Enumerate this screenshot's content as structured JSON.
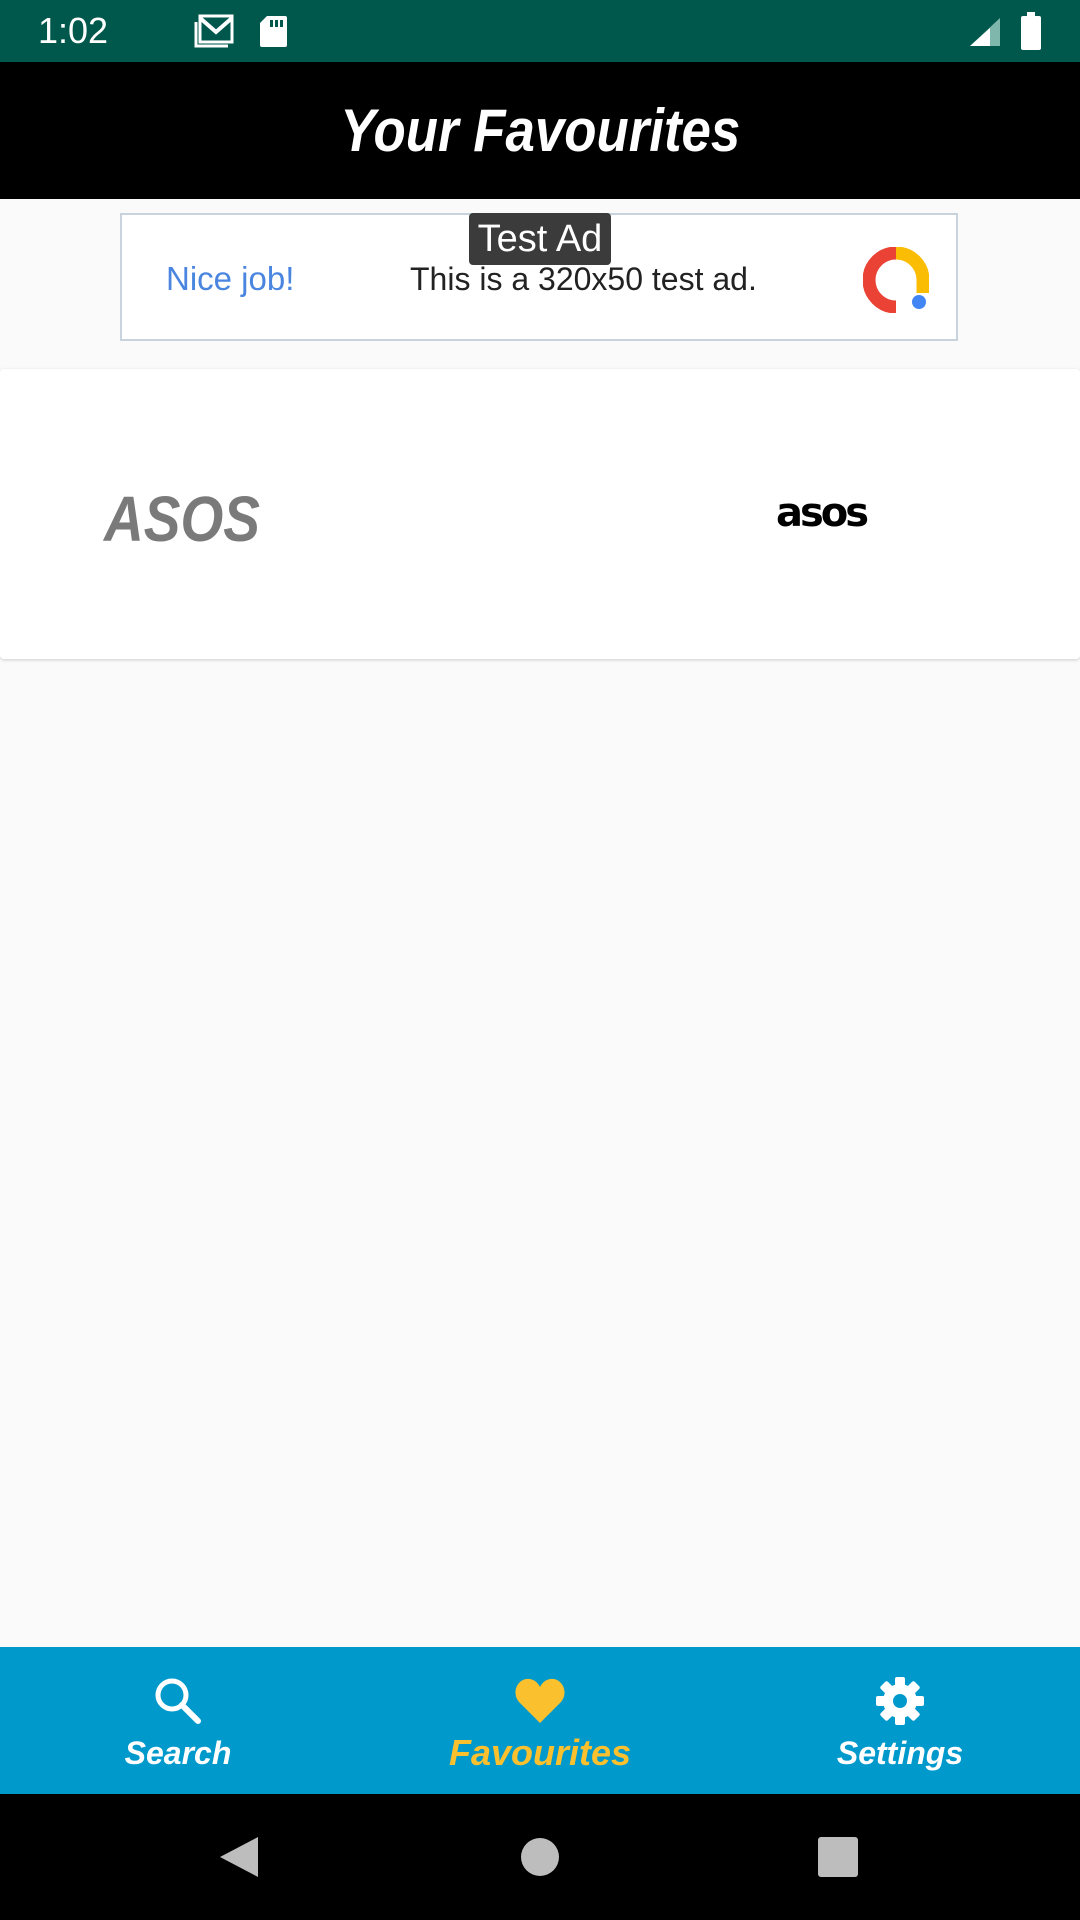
{
  "status_bar": {
    "time": "1:02",
    "background_color": "#00574b",
    "icons": [
      "gmail-icon",
      "sd-card-icon",
      "signal-icon",
      "battery-icon"
    ]
  },
  "app_bar": {
    "title": "Your Favourites",
    "background_color": "#000000"
  },
  "ad": {
    "tag": "Test Ad",
    "headline": "Nice job!",
    "description": "This is a 320x50 test ad.",
    "logo_icon": "admob-logo-icon"
  },
  "favourites": [
    {
      "name": "ASOS",
      "logo_text": "asos"
    }
  ],
  "bottom_nav": {
    "background_color": "#0099cc",
    "active_color": "#fbc02d",
    "items": [
      {
        "label": "Search",
        "icon": "search-icon",
        "active": false
      },
      {
        "label": "Favourites",
        "icon": "heart-icon",
        "active": true
      },
      {
        "label": "Settings",
        "icon": "gear-icon",
        "active": false
      }
    ]
  },
  "system_nav": {
    "buttons": [
      "back-icon",
      "home-icon",
      "recents-icon"
    ]
  }
}
